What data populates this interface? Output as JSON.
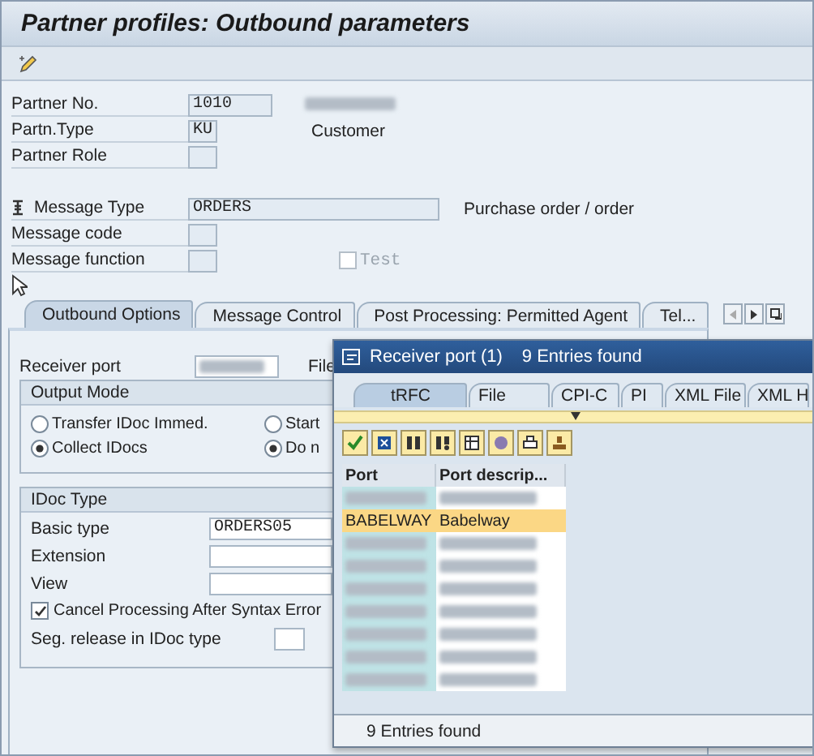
{
  "window": {
    "title": "Partner profiles: Outbound parameters"
  },
  "header_fields": [
    {
      "kind": "field",
      "label": "Partner No.",
      "value": "1010"
    },
    {
      "kind": "field",
      "label": "Partn.Type",
      "value": "KU",
      "note": "Customer"
    },
    {
      "kind": "field",
      "label": "Partner Role"
    },
    {
      "kind": "gap"
    },
    {
      "kind": "field",
      "label": "Message Type",
      "value": "ORDERS",
      "note": "Purchase order / order",
      "icon": true
    },
    {
      "kind": "field",
      "label": "Message code"
    },
    {
      "kind": "field",
      "label": "Message function",
      "checkbox": {
        "label": "Test",
        "checked": false,
        "disabled": true
      }
    }
  ],
  "tabs": [
    {
      "label": "Outbound Options",
      "selected": true
    },
    {
      "label": "Message Control",
      "selected": false
    },
    {
      "label": "Post Processing: Permitted Agent",
      "selected": false
    },
    {
      "label": "Tel...",
      "selected": false
    }
  ],
  "receiver_port": {
    "label": "Receiver port",
    "side_label": "File"
  },
  "output_mode": {
    "title": "Output Mode",
    "radios": [
      {
        "label": "Transfer IDoc Immed.",
        "selected": false
      },
      {
        "label": "Start",
        "selected": false
      },
      {
        "label": "Collect IDocs",
        "selected": true
      },
      {
        "label": "Do n",
        "selected": true
      }
    ]
  },
  "idoc_type": {
    "title": "IDoc Type",
    "fields": [
      {
        "label": "Basic type",
        "value": "ORDERS05"
      },
      {
        "label": "Extension"
      },
      {
        "label": "View"
      }
    ],
    "cancel_processing": {
      "label": "Cancel Processing After Syntax Error",
      "checked": true
    },
    "seg_release": {
      "label": "Seg. release in IDoc type"
    }
  },
  "popup": {
    "title": "Receiver port (1)",
    "count": "9 Entries found",
    "tabs": [
      {
        "label": "tRFC",
        "selected": true
      },
      {
        "label": "File",
        "selected": false
      },
      {
        "label": "CPI-C",
        "selected": false
      },
      {
        "label": "PI",
        "selected": false
      },
      {
        "label": "XML File",
        "selected": false
      },
      {
        "label": "XML H",
        "selected": false
      }
    ],
    "columns": [
      "Port",
      "Port descrip..."
    ],
    "rows": [
      {
        "kind": "blurred",
        "selected": false
      },
      {
        "kind": "text",
        "port": "BABELWAY",
        "description": "Babelway",
        "selected": true
      },
      {
        "kind": "blurred",
        "selected": false
      },
      {
        "kind": "blurred",
        "selected": false
      },
      {
        "kind": "blurred",
        "selected": false
      },
      {
        "kind": "blurred",
        "selected": false
      },
      {
        "kind": "blurred",
        "selected": false
      },
      {
        "kind": "blurred",
        "selected": false
      },
      {
        "kind": "blurred",
        "selected": false
      }
    ],
    "status": "9 Entries found"
  }
}
